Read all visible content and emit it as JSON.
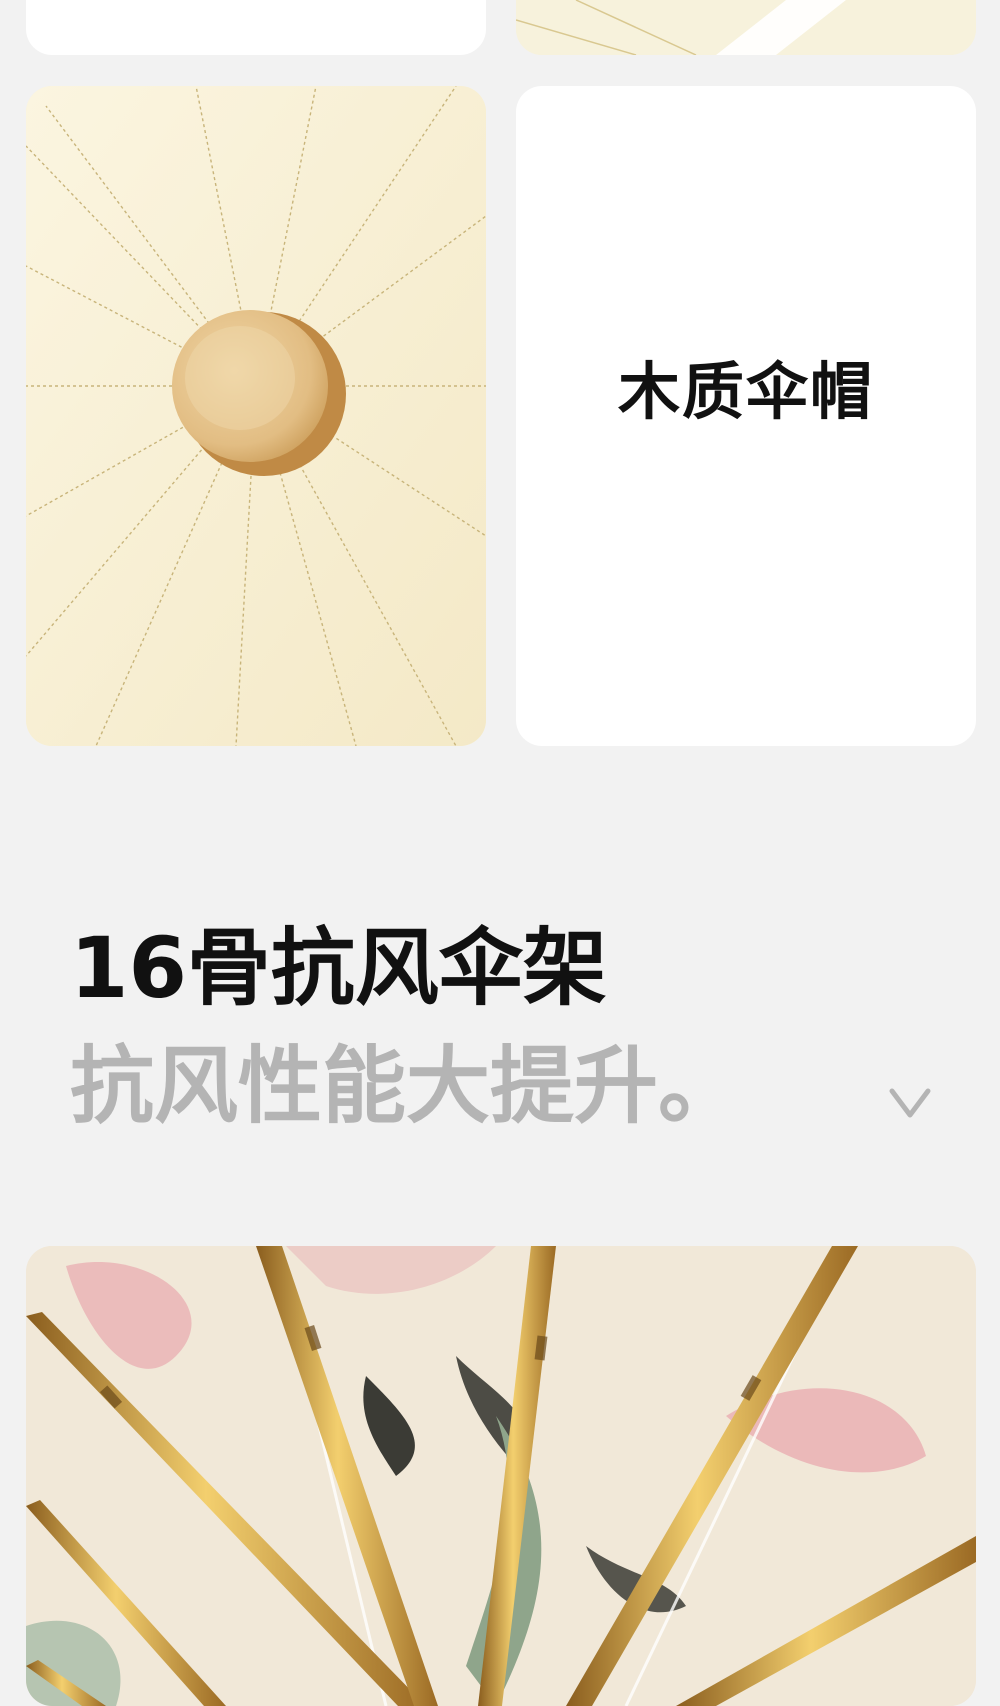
{
  "cap_section": {
    "label": "木质伞帽"
  },
  "frame_section": {
    "title": "16骨抗风伞架",
    "subtitle": "抗风性能大提升。"
  },
  "icons": {
    "expand": "chevron-down-icon"
  },
  "colors": {
    "page_background": "#f2f2f2",
    "title": "#111111",
    "subtitle": "#b4b4b4",
    "canopy_cream": "#f8f1d8",
    "wood": "#e2bd83",
    "rib_gold": "#c9962f",
    "ink_pink": "#eab0b4",
    "ink_dark": "#3b3b35",
    "ink_green": "#8fa58b"
  }
}
